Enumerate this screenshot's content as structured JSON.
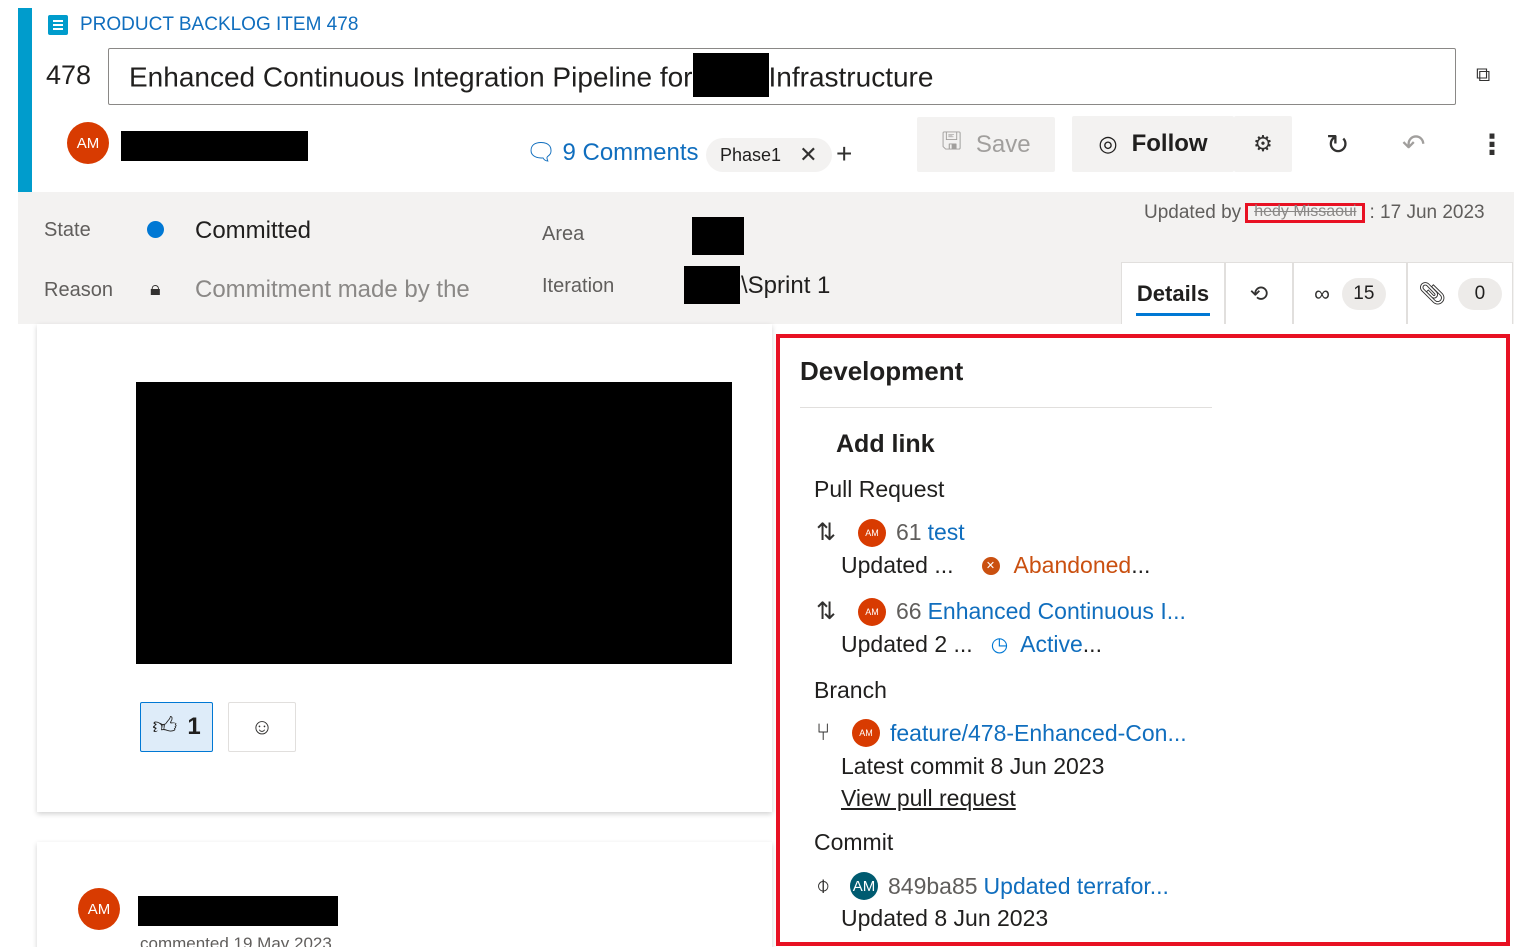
{
  "header": {
    "type_label": "PRODUCT BACKLOG ITEM 478",
    "item_id": "478",
    "title_part1": "Enhanced Continuous Integration Pipeline for",
    "title_part2": "Infrastructure",
    "avatar_initials": "AM",
    "comments_label": "9 Comments",
    "tag_label": "Phase1",
    "save_label": "Save",
    "follow_label": "Follow"
  },
  "fields": {
    "state_label": "State",
    "state_value": "Committed",
    "reason_label": "Reason",
    "reason_value": "Commitment made by the",
    "area_label": "Area",
    "iteration_label": "Iteration",
    "iteration_value": "\\Sprint 1",
    "updated_by_prefix": "Updated by",
    "updated_by_name": "hedy Missaoui",
    "updated_by_date": ": 17 Jun 2023"
  },
  "tabs": {
    "details_label": "Details",
    "links_count": "15",
    "attachments_count": "0"
  },
  "discussion": {
    "reaction_count": "1",
    "comment_avatar": "AM",
    "comment_meta": "commented 19 May 2023"
  },
  "development": {
    "title": "Development",
    "add_link": "Add link",
    "pull_request_title": "Pull Request",
    "pull_requests": [
      {
        "avatar": "AM",
        "number": "61",
        "name": "test",
        "updated": "Updated ...",
        "status": "Abandoned",
        "status_suffix": "..."
      },
      {
        "avatar": "AM",
        "number": "66",
        "name": "Enhanced Continuous I...",
        "updated": "Updated 2 ...",
        "status": "Active",
        "status_suffix": "..."
      }
    ],
    "branch_title": "Branch",
    "branch": {
      "avatar": "AM",
      "name": "feature/478-Enhanced-Con...",
      "latest_commit": "Latest commit 8 Jun 2023",
      "view_pr": "View pull request"
    },
    "commit_title": "Commit",
    "commit": {
      "avatar": "AM",
      "hash": "849ba85",
      "message": "Updated terrafor...",
      "updated": "Updated 8 Jun 2023"
    }
  },
  "colors": {
    "accent": "#009ccc",
    "link": "#106ebe",
    "state_dot": "#0078d4",
    "abandoned": "#ca5010",
    "highlight_border": "#e81123"
  }
}
